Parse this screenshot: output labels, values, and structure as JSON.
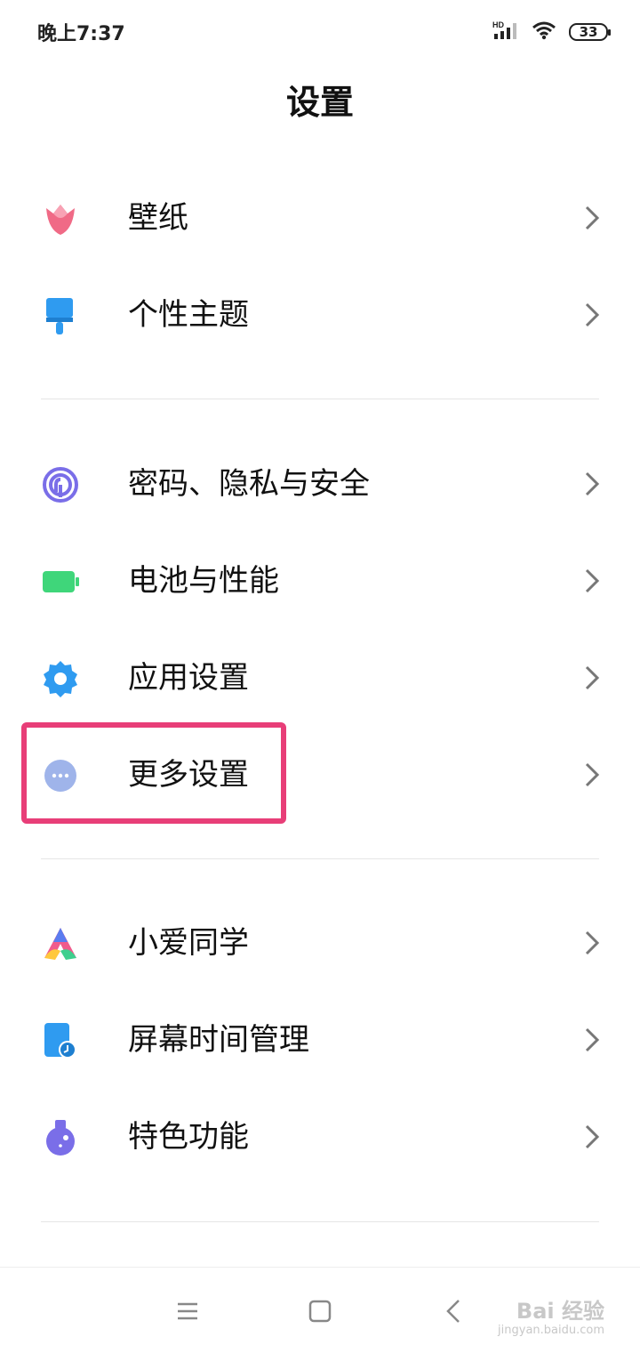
{
  "status_bar": {
    "time": "晚上7:37",
    "network": "HD",
    "battery": "33"
  },
  "page": {
    "title": "设置"
  },
  "items": [
    {
      "label": "壁纸",
      "icon": "tulip-icon"
    },
    {
      "label": "个性主题",
      "icon": "paint-brush-icon"
    },
    {
      "label": "密码、隐私与安全",
      "icon": "fingerprint-icon"
    },
    {
      "label": "电池与性能",
      "icon": "battery-icon"
    },
    {
      "label": "应用设置",
      "icon": "gear-icon"
    },
    {
      "label": "更多设置",
      "icon": "more-dots-icon"
    },
    {
      "label": "小爱同学",
      "icon": "xiaoai-icon"
    },
    {
      "label": "屏幕时间管理",
      "icon": "screen-time-icon"
    },
    {
      "label": "特色功能",
      "icon": "flask-icon"
    }
  ],
  "colors": {
    "highlight": "#e83e78",
    "accent_blue": "#2f9bf0",
    "battery_green": "#3fd67a"
  },
  "watermark": {
    "text": "Bai 经验",
    "url_text": "jingyan.baidu.com"
  }
}
